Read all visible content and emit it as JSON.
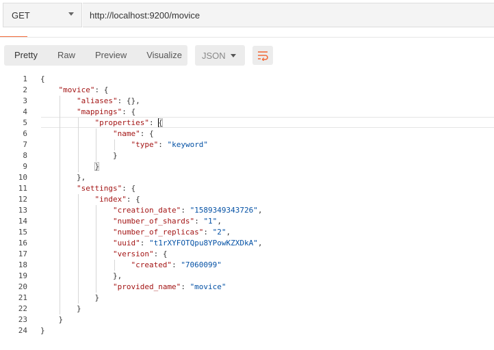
{
  "request": {
    "method": "GET",
    "url": "http://localhost:9200/movice"
  },
  "response_toolbar": {
    "tabs": [
      {
        "label": "Pretty",
        "active": true
      },
      {
        "label": "Raw",
        "active": false
      },
      {
        "label": "Preview",
        "active": false
      },
      {
        "label": "Visualize",
        "active": false
      }
    ],
    "language": "JSON",
    "wrap_icon": "wrap-lines-icon"
  },
  "colors": {
    "key": "#a31515",
    "string": "#0451a5",
    "accent": "#f26b3a"
  },
  "code": {
    "cursor_line": 5,
    "lines": [
      [
        {
          "t": "p",
          "v": "{"
        }
      ],
      [
        {
          "t": "p",
          "v": "    "
        },
        {
          "t": "k",
          "v": "\"movice\""
        },
        {
          "t": "p",
          "v": ": {"
        }
      ],
      [
        {
          "t": "p",
          "v": "        "
        },
        {
          "t": "k",
          "v": "\"aliases\""
        },
        {
          "t": "p",
          "v": ": {},"
        }
      ],
      [
        {
          "t": "p",
          "v": "        "
        },
        {
          "t": "k",
          "v": "\"mappings\""
        },
        {
          "t": "p",
          "v": ": {"
        }
      ],
      [
        {
          "t": "p",
          "v": "            "
        },
        {
          "t": "k",
          "v": "\"properties\""
        },
        {
          "t": "p",
          "v": ": {"
        }
      ],
      [
        {
          "t": "p",
          "v": "                "
        },
        {
          "t": "k",
          "v": "\"name\""
        },
        {
          "t": "p",
          "v": ": {"
        }
      ],
      [
        {
          "t": "p",
          "v": "                    "
        },
        {
          "t": "k",
          "v": "\"type\""
        },
        {
          "t": "p",
          "v": ": "
        },
        {
          "t": "s",
          "v": "\"keyword\""
        }
      ],
      [
        {
          "t": "p",
          "v": "                }"
        }
      ],
      [
        {
          "t": "p",
          "v": "            }"
        }
      ],
      [
        {
          "t": "p",
          "v": "        },"
        }
      ],
      [
        {
          "t": "p",
          "v": "        "
        },
        {
          "t": "k",
          "v": "\"settings\""
        },
        {
          "t": "p",
          "v": ": {"
        }
      ],
      [
        {
          "t": "p",
          "v": "            "
        },
        {
          "t": "k",
          "v": "\"index\""
        },
        {
          "t": "p",
          "v": ": {"
        }
      ],
      [
        {
          "t": "p",
          "v": "                "
        },
        {
          "t": "k",
          "v": "\"creation_date\""
        },
        {
          "t": "p",
          "v": ": "
        },
        {
          "t": "s",
          "v": "\"1589349343726\""
        },
        {
          "t": "p",
          "v": ","
        }
      ],
      [
        {
          "t": "p",
          "v": "                "
        },
        {
          "t": "k",
          "v": "\"number_of_shards\""
        },
        {
          "t": "p",
          "v": ": "
        },
        {
          "t": "s",
          "v": "\"1\""
        },
        {
          "t": "p",
          "v": ","
        }
      ],
      [
        {
          "t": "p",
          "v": "                "
        },
        {
          "t": "k",
          "v": "\"number_of_replicas\""
        },
        {
          "t": "p",
          "v": ": "
        },
        {
          "t": "s",
          "v": "\"2\""
        },
        {
          "t": "p",
          "v": ","
        }
      ],
      [
        {
          "t": "p",
          "v": "                "
        },
        {
          "t": "k",
          "v": "\"uuid\""
        },
        {
          "t": "p",
          "v": ": "
        },
        {
          "t": "s",
          "v": "\"t1rXYFOTQpu8YPowKZXDkA\""
        },
        {
          "t": "p",
          "v": ","
        }
      ],
      [
        {
          "t": "p",
          "v": "                "
        },
        {
          "t": "k",
          "v": "\"version\""
        },
        {
          "t": "p",
          "v": ": {"
        }
      ],
      [
        {
          "t": "p",
          "v": "                    "
        },
        {
          "t": "k",
          "v": "\"created\""
        },
        {
          "t": "p",
          "v": ": "
        },
        {
          "t": "s",
          "v": "\"7060099\""
        }
      ],
      [
        {
          "t": "p",
          "v": "                },"
        }
      ],
      [
        {
          "t": "p",
          "v": "                "
        },
        {
          "t": "k",
          "v": "\"provided_name\""
        },
        {
          "t": "p",
          "v": ": "
        },
        {
          "t": "s",
          "v": "\"movice\""
        }
      ],
      [
        {
          "t": "p",
          "v": "            }"
        }
      ],
      [
        {
          "t": "p",
          "v": "        }"
        }
      ],
      [
        {
          "t": "p",
          "v": "    }"
        }
      ],
      [
        {
          "t": "p",
          "v": "}"
        }
      ]
    ]
  }
}
